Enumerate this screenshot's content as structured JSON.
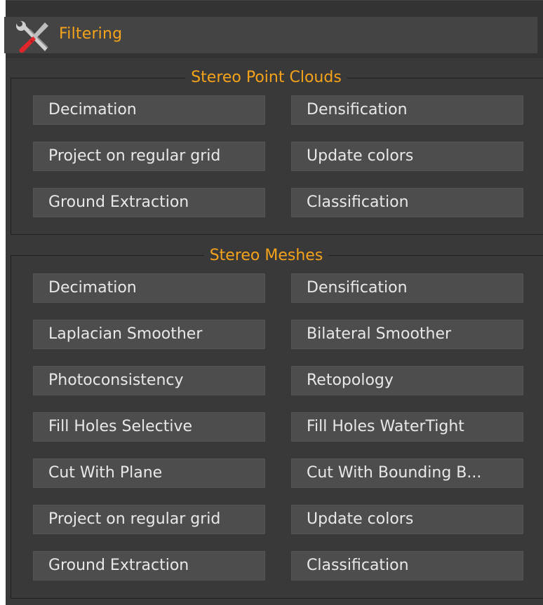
{
  "header": {
    "title": "Filtering",
    "icon": "tools-icon"
  },
  "accent_color": "#f5a31a",
  "groups": [
    {
      "title": "Stereo Point Clouds",
      "buttons": [
        "Decimation",
        "Densification",
        "Project on regular grid",
        "Update colors",
        "Ground Extraction",
        "Classification"
      ]
    },
    {
      "title": "Stereo Meshes",
      "buttons": [
        "Decimation",
        "Densification",
        "Laplacian Smoother",
        "Bilateral Smoother",
        "Photoconsistency",
        "Retopology",
        "Fill Holes Selective",
        "Fill Holes WaterTight",
        "Cut With Plane",
        "Cut With Bounding B...",
        "Project on regular grid",
        "Update colors",
        "Ground Extraction",
        "Classification"
      ]
    }
  ]
}
